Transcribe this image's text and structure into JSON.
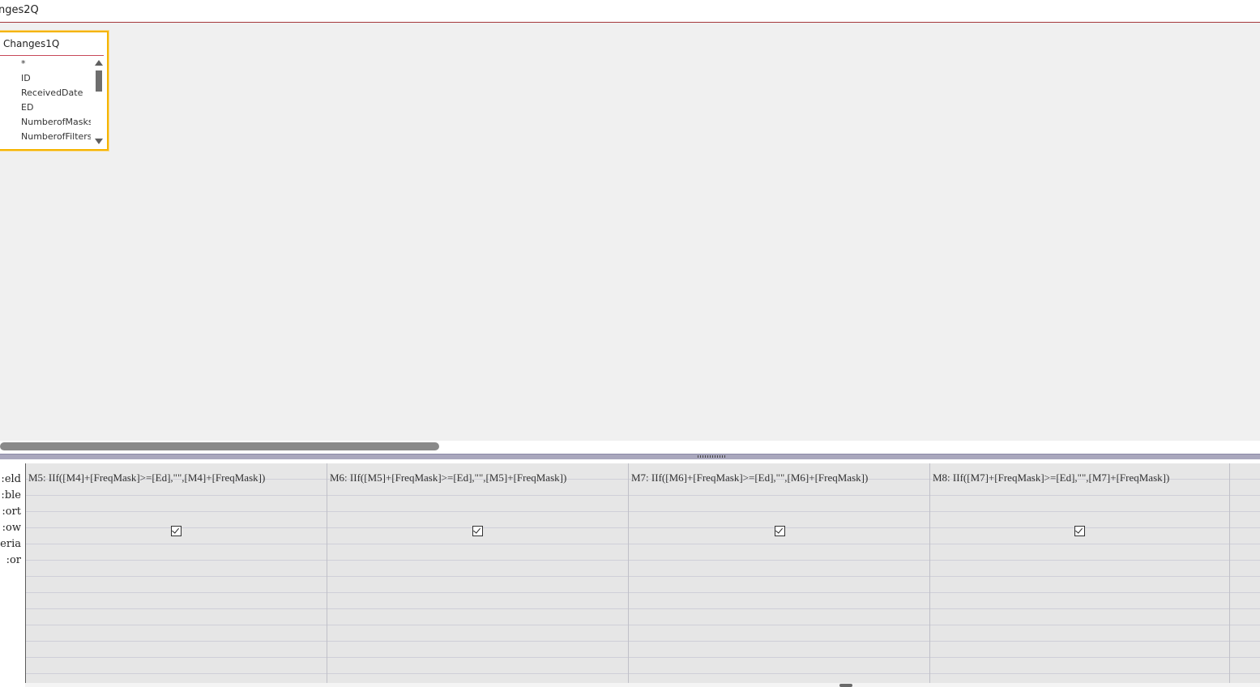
{
  "window": {
    "tab_title": "nges2Q"
  },
  "table_box": {
    "title": "Changes1Q",
    "fields": [
      "*",
      "ID",
      "ReceivedDate",
      "ED",
      "NumberofMasks",
      "NumberofFilters"
    ]
  },
  "grid": {
    "row_labels": [
      "eld:",
      "ble:",
      "ort:",
      "ow:",
      "eria:",
      "or:"
    ],
    "columns": [
      {
        "field": "M5: IIf([M4]+[FreqMask]>=[Ed],\"\",[M4]+[FreqMask])",
        "show": true
      },
      {
        "field": "M6: IIf([M5]+[FreqMask]>=[Ed],\"\",[M5]+[FreqMask])",
        "show": true
      },
      {
        "field": "M7: IIf([M6]+[FreqMask]>=[Ed],\"\",[M6]+[FreqMask])",
        "show": true
      },
      {
        "field": "M8: IIf([M7]+[FreqMask]>=[Ed],\"\",[M7]+[FreqMask])",
        "show": true
      },
      {
        "field": "",
        "show": false
      }
    ]
  },
  "colors": {
    "accent": "#a4373a",
    "table_border": "#f5b400",
    "pane_bg": "#f0f0f0",
    "grid_bg": "#e6e6e6"
  }
}
